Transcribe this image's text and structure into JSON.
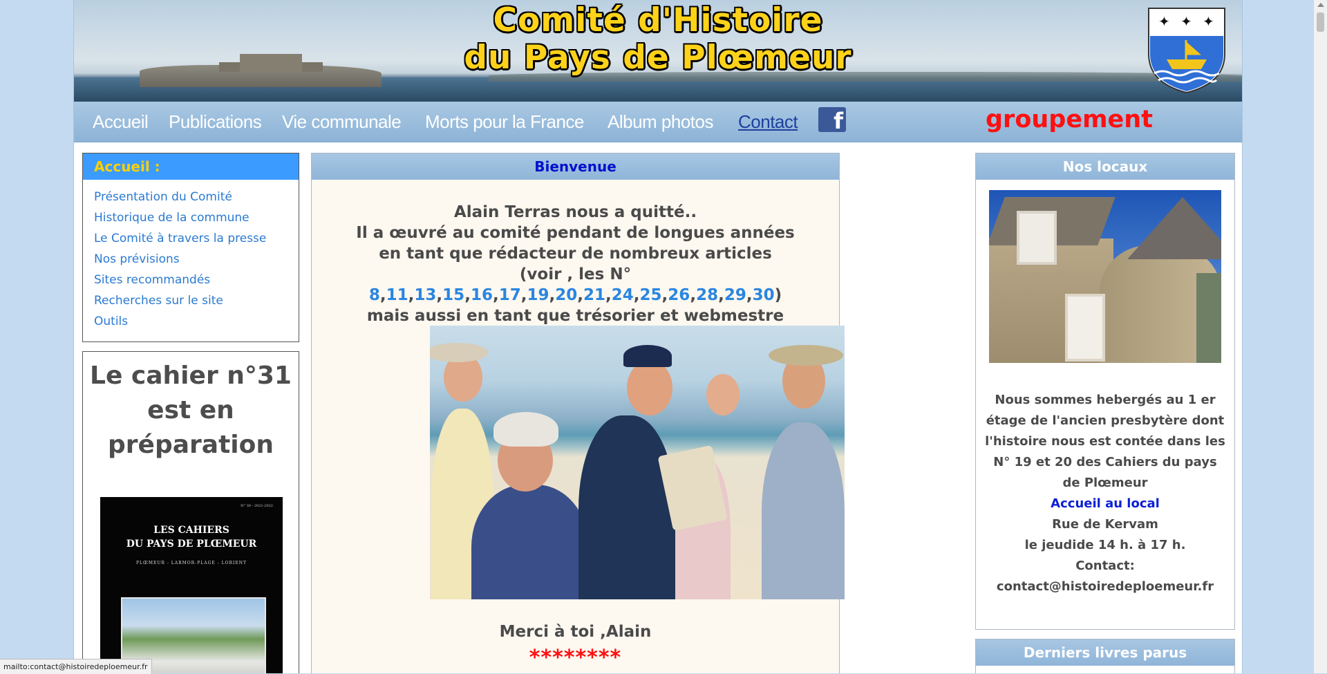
{
  "banner": {
    "title_line1": "Comité d'Histoire",
    "title_line2": "du Pays de Plœmeur"
  },
  "nav": {
    "items": [
      "Accueil",
      "Publications",
      "Vie communale",
      "Morts pour la France",
      "Album photos",
      "Contact"
    ],
    "active": "Contact",
    "groupement": "groupement"
  },
  "left_menu": {
    "title": "Accueil :",
    "items": [
      "Présentation du Comité",
      "Historique de la commune",
      "Le Comité à travers la presse",
      "Nos prévisions",
      "Sites recommandés",
      "Recherches sur le site",
      "Outils"
    ]
  },
  "promo": {
    "line1": "Le cahier n°31",
    "line2": "est en",
    "line3": "préparation",
    "cover_issue": "N° 30 - 2021-2022",
    "cover_title1": "LES CAHIERS",
    "cover_title2": "DU PAYS DE PLŒMEUR",
    "cover_subtitle": "PLŒMEUR  -  LARMOR-PLAGE  -  LORIENT"
  },
  "center": {
    "title": "Bienvenue",
    "line1": "Alain Terras nous a quitté..",
    "line2": "Il a œuvré au comité pendant de longues années",
    "line3": "en tant que rédacteur de nombreux articles",
    "voir_prefix": "(voir , les N° ",
    "issue_links": [
      "8",
      "11",
      "13",
      "15",
      "16",
      "17",
      "19",
      "20",
      "21",
      "24",
      "25",
      "26",
      "28",
      "29",
      "30"
    ],
    "voir_suffix": ")",
    "line5": "mais aussi en tant que trésorier et webmestre",
    "merci": "Merci à toi ,Alain",
    "stars": "********"
  },
  "right": {
    "title": "Nos locaux",
    "text1": "Nous sommes hebergés au 1 er étage de l'ancien presbytère dont l'histoire nous est contée dans les N° 19 et 20 des Cahiers du pays de Plœmeur",
    "accueil": "Accueil au local",
    "address": "Rue de Kervam",
    "hours": "le jeudide 14 h. à 17 h.",
    "contact_label": "Contact:",
    "contact_email": "contact@histoiredeploemeur.fr",
    "books_title": "Derniers livres parus"
  },
  "status_bar": "mailto:contact@histoiredeploemeur.fr",
  "colors": {
    "background": "#c3daf1",
    "nav": "#9bbde0",
    "menu_head": "#3b9bff",
    "link": "#2a7ad1",
    "accent_red": "#ff1010",
    "title_yellow": "#ffd21a"
  }
}
